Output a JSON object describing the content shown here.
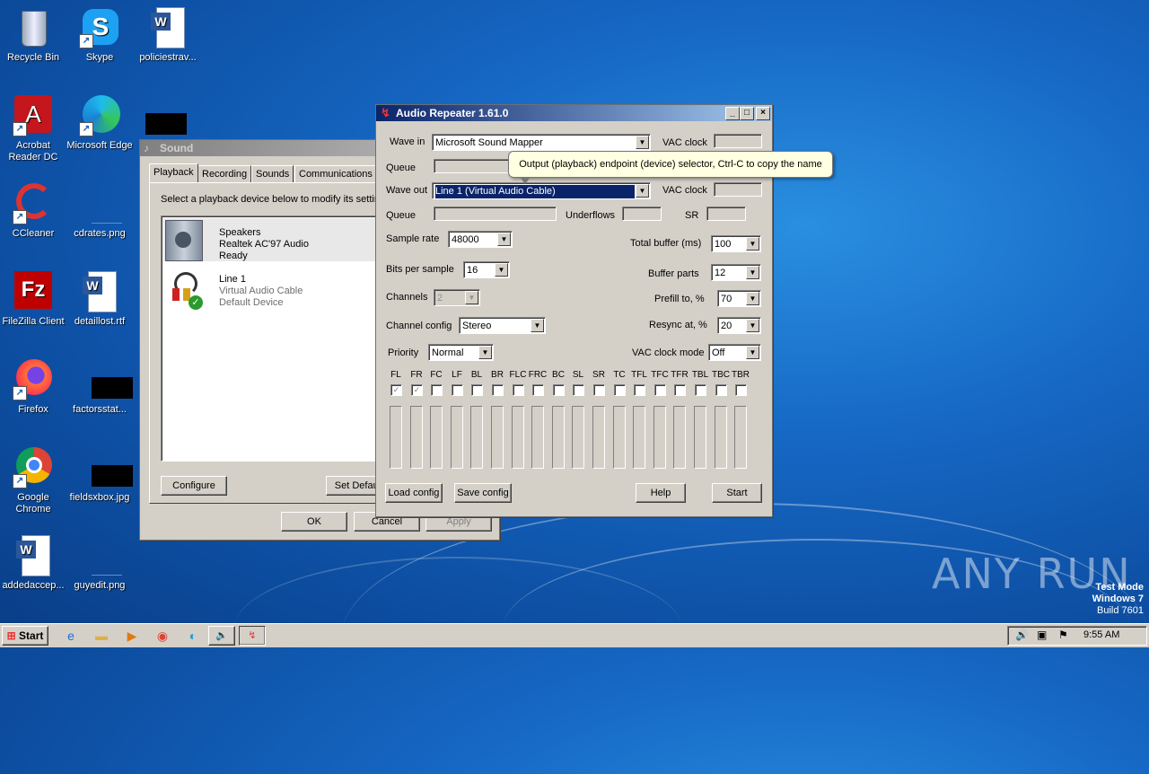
{
  "desktop": {
    "icons": [
      {
        "label": "Recycle Bin",
        "icon": "recycle-bin-icon"
      },
      {
        "label": "Skype",
        "icon": "skype-icon"
      },
      {
        "label": "policiestrav...",
        "icon": "word-document-icon"
      },
      {
        "label": "Acrobat Reader DC",
        "icon": "acrobat-icon"
      },
      {
        "label": "Microsoft Edge",
        "icon": "edge-icon"
      },
      {
        "label": "CCleaner",
        "icon": "ccleaner-icon"
      },
      {
        "label": "cdrates.png",
        "icon": "png-file-icon"
      },
      {
        "label": "FileZilla Client",
        "icon": "filezilla-icon"
      },
      {
        "label": "detaillost.rtf",
        "icon": "word-document-icon"
      },
      {
        "label": "Firefox",
        "icon": "firefox-icon"
      },
      {
        "label": "factorsstat...",
        "icon": "redacted-file-icon"
      },
      {
        "label": "Google Chrome",
        "icon": "chrome-icon"
      },
      {
        "label": "fieldsxbox.jpg",
        "icon": "redacted-file-icon"
      },
      {
        "label": "addedaccep...",
        "icon": "word-document-icon"
      },
      {
        "label": "guyedit.png",
        "icon": "png-file-icon"
      }
    ],
    "watermark": "ANY RUN",
    "test_mode": [
      "Test Mode",
      "Windows 7",
      "Build 7601"
    ]
  },
  "sound_window": {
    "title": "Sound",
    "tabs": [
      "Playback",
      "Recording",
      "Sounds",
      "Communications"
    ],
    "instruction": "Select a playback device below to modify its settings:",
    "devices": [
      {
        "name": "Speakers",
        "detail": "Realtek AC'97 Audio",
        "status": "Ready"
      },
      {
        "name": "Line 1",
        "detail": "Virtual Audio Cable",
        "status": "Default Device"
      }
    ],
    "configure_label": "Configure",
    "set_default_label": "Set Default",
    "ok_label": "OK",
    "cancel_label": "Cancel",
    "apply_label": "Apply"
  },
  "repeater": {
    "title": "Audio Repeater 1.61.0",
    "wave_in_label": "Wave in",
    "wave_in_value": "Microsoft Sound Mapper",
    "vac_clock_label": "VAC clock",
    "queue_label": "Queue",
    "wave_out_label": "Wave out",
    "wave_out_value": "Line 1 (Virtual Audio Cable)",
    "underflows_label": "Underflows",
    "sr_label": "SR",
    "tooltip": "Output (playback) endpoint (device) selector, Ctrl-C to copy the name",
    "sample_rate_label": "Sample rate",
    "sample_rate_value": "48000",
    "bits_label": "Bits per sample",
    "bits_value": "16",
    "channels_label": "Channels",
    "channels_value": "2",
    "channel_config_label": "Channel config",
    "channel_config_value": "Stereo",
    "priority_label": "Priority",
    "priority_value": "Normal",
    "total_buffer_label": "Total buffer (ms)",
    "total_buffer_value": "100",
    "buffer_parts_label": "Buffer parts",
    "buffer_parts_value": "12",
    "prefill_label": "Prefill to, %",
    "prefill_value": "70",
    "resync_label": "Resync at, %",
    "resync_value": "20",
    "vac_clock_mode_label": "VAC clock mode",
    "vac_clock_mode_value": "Off",
    "channel_names": [
      "FL",
      "FR",
      "FC",
      "LF",
      "BL",
      "BR",
      "FLC",
      "FRC",
      "BC",
      "SL",
      "SR",
      "TC",
      "TFL",
      "TFC",
      "TFR",
      "TBL",
      "TBC",
      "TBR"
    ],
    "channels_checked": [
      true,
      true,
      false,
      false,
      false,
      false,
      false,
      false,
      false,
      false,
      false,
      false,
      false,
      false,
      false,
      false,
      false,
      false
    ],
    "load_config_label": "Load config",
    "save_config_label": "Save config",
    "help_label": "Help",
    "start_label": "Start"
  },
  "taskbar": {
    "start_label": "Start",
    "clock": "9:55 AM"
  }
}
